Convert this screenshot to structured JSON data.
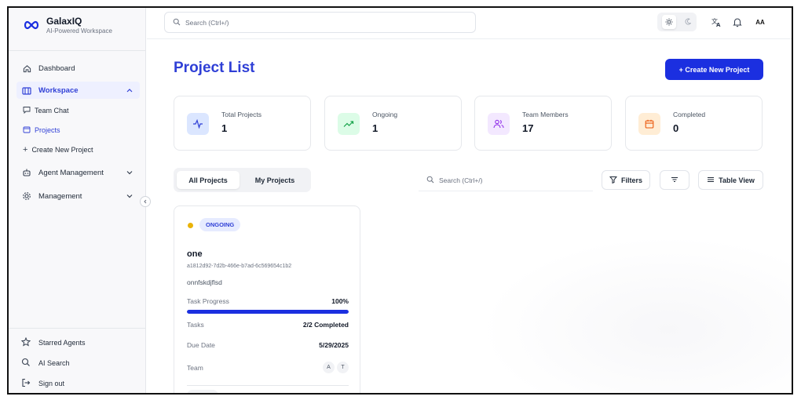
{
  "brand": {
    "title": "GalaxIQ",
    "subtitle": "AI-Powered Workspace"
  },
  "sidebar": {
    "dashboard": "Dashboard",
    "workspace": "Workspace",
    "workspace_children": [
      "Team Chat",
      "Projects",
      "Create New Project"
    ],
    "agent_management": "Agent Management",
    "management": "Management",
    "bottom": [
      "Starred Agents",
      "AI Search",
      "Sign out"
    ]
  },
  "topbar": {
    "search_placeholder": "Search (Ctrl+/)",
    "avatar_initials": "AA"
  },
  "page": {
    "title": "Project List",
    "create_button": "+ Create New Project"
  },
  "stats": [
    {
      "label": "Total Projects",
      "value": "1",
      "icon": "activity-icon",
      "color": "#dbe6ff"
    },
    {
      "label": "Ongoing",
      "value": "1",
      "icon": "trending-up-icon",
      "color": "#dcfce7"
    },
    {
      "label": "Team Members",
      "value": "17",
      "icon": "users-icon",
      "color": "#f3e8ff"
    },
    {
      "label": "Completed",
      "value": "0",
      "icon": "calendar-icon",
      "color": "#ffedd5"
    }
  ],
  "tabs": [
    "All Projects",
    "My Projects"
  ],
  "list_search_placeholder": "Search (Ctrl+/)",
  "toolbar": {
    "filters": "Filters",
    "view": "Table View"
  },
  "project": {
    "status": "ONGOING",
    "name": "one",
    "id": "a1812d92-7d2b-466e-b7ad-6c569654c1b2",
    "description": "onnfskdjflsd",
    "progress_label": "Task Progress",
    "progress_value": "100%",
    "progress_fraction": 1.0,
    "tasks_label": "Tasks",
    "tasks_value": "2/2 Completed",
    "due_label": "Due Date",
    "due_value": "5/29/2025",
    "team_label": "Team",
    "team": [
      "A",
      "T"
    ]
  }
}
